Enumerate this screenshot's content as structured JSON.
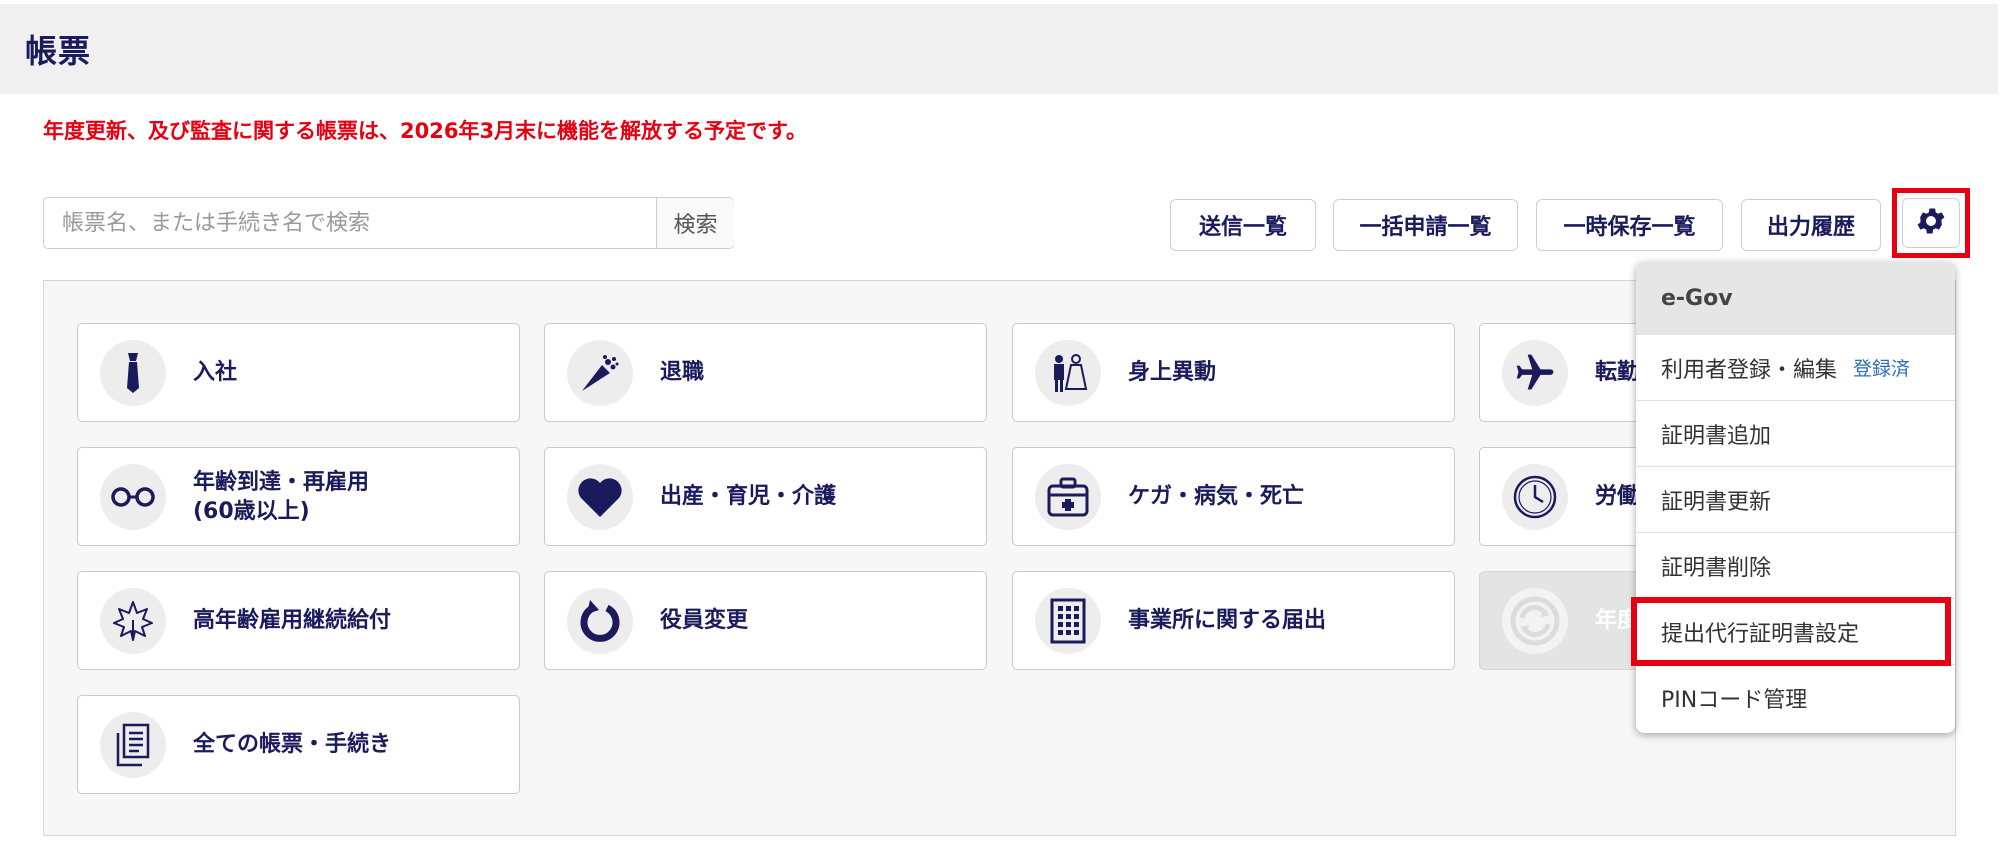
{
  "header": {
    "title": "帳票"
  },
  "notice": "年度更新、及び監査に関する帳票は、2026年3月末に機能を解放する予定です。",
  "search": {
    "placeholder": "帳票名、または手続き名で検索",
    "value": "",
    "button_label": "検索"
  },
  "toolbar": {
    "buttons": [
      {
        "label": "送信一覧"
      },
      {
        "label": "一括申請一覧"
      },
      {
        "label": "一時保存一覧"
      },
      {
        "label": "出力履歴"
      }
    ],
    "settings_icon": "gear-icon"
  },
  "cards": [
    {
      "label": "入社",
      "icon": "necktie-icon",
      "enabled": true
    },
    {
      "label": "退職",
      "icon": "bouquet-icon",
      "enabled": true
    },
    {
      "label": "身上異動",
      "icon": "wedding-couple-icon",
      "enabled": true
    },
    {
      "label": "転勤",
      "icon": "airplane-icon",
      "enabled": true
    },
    {
      "label": "年齢到達・再雇用\n(60歳以上)",
      "icon": "glasses-icon",
      "enabled": true
    },
    {
      "label": "出産・育児・介護",
      "icon": "heart-icon",
      "enabled": true
    },
    {
      "label": "ケガ・病気・死亡",
      "icon": "first-aid-kit-icon",
      "enabled": true
    },
    {
      "label": "労働",
      "icon": "clock-icon",
      "enabled": true
    },
    {
      "label": "高年齢雇用継続給付",
      "icon": "maple-leaf-icon",
      "enabled": true
    },
    {
      "label": "役員変更",
      "icon": "refresh-arrow-icon",
      "enabled": true
    },
    {
      "label": "事業所に関する届出",
      "icon": "building-icon",
      "enabled": true
    },
    {
      "label": "年度",
      "icon": "sync-icon",
      "enabled": false
    },
    {
      "label": "全ての帳票・手続き",
      "icon": "documents-icon",
      "enabled": true
    }
  ],
  "settings_menu": {
    "header": "e-Gov",
    "items": [
      {
        "label": "利用者登録・編集",
        "badge": "登録済"
      },
      {
        "label": "証明書追加"
      },
      {
        "label": "証明書更新"
      },
      {
        "label": "証明書削除"
      },
      {
        "label": "提出代行証明書設定",
        "highlighted": true
      },
      {
        "label": "PINコード管理"
      }
    ]
  },
  "colors": {
    "navy": "#1a1a5c",
    "alert_red": "#e60012",
    "link_blue": "#2a6ebb"
  }
}
